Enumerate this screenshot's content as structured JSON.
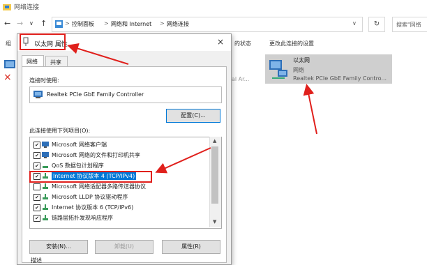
{
  "window": {
    "title": "网络连接"
  },
  "nav": {
    "back": "←",
    "forward": "→",
    "down": "∨",
    "up": "↑"
  },
  "address": {
    "crumbs": [
      "控制面板",
      "网络和 Internet",
      "网络连接"
    ],
    "sep": ">",
    "dropdown": "∨"
  },
  "refresh": "↻",
  "search": {
    "placeholder": "搜索\"网络"
  },
  "cmdbar": {
    "left_trunc": "组",
    "status": "的状态",
    "change": "更改此连接的设置"
  },
  "adapters": {
    "ethernet": {
      "name": "以太网",
      "status": "网络",
      "device": "Realtek PCIe GbE Family Contro..."
    },
    "ghost": "onal Ar..."
  },
  "dialog": {
    "title": "以太网 属性",
    "close": "×",
    "tabs": [
      "网络",
      "共享"
    ],
    "connect_using_label": "连接时使用:",
    "adapter_name": "Realtek PCIe GbE Family Controller",
    "configure_button": "配置(C)...",
    "items_label": "此连接使用下列项目(O):",
    "items": [
      {
        "text": "Microsoft 网络客户端",
        "checked": "✔"
      },
      {
        "text": "Microsoft 网络的文件和打印机共享",
        "checked": "✔"
      },
      {
        "text": "QoS 数据包计划程序",
        "checked": "✔"
      },
      {
        "text": "Internet 协议版本 4 (TCP/IPv4)",
        "checked": "✔"
      },
      {
        "text": "Microsoft 网络适配器多路传送器协议",
        "checked": ""
      },
      {
        "text": "Microsoft LLDP 协议驱动程序",
        "checked": "✔"
      },
      {
        "text": "Internet 协议版本 6 (TCP/IPv6)",
        "checked": "✔"
      },
      {
        "text": "链路层拓扑发现响应程序",
        "checked": "✔"
      }
    ],
    "scroll_up": "▲",
    "scroll_down": "▼",
    "install_button": "安装(N)...",
    "uninstall_button": "卸载(U)",
    "properties_button": "属性(R)",
    "description_label": "描述"
  },
  "colors": {
    "highlight": "#0078d7",
    "annotation": "#e0201c"
  }
}
